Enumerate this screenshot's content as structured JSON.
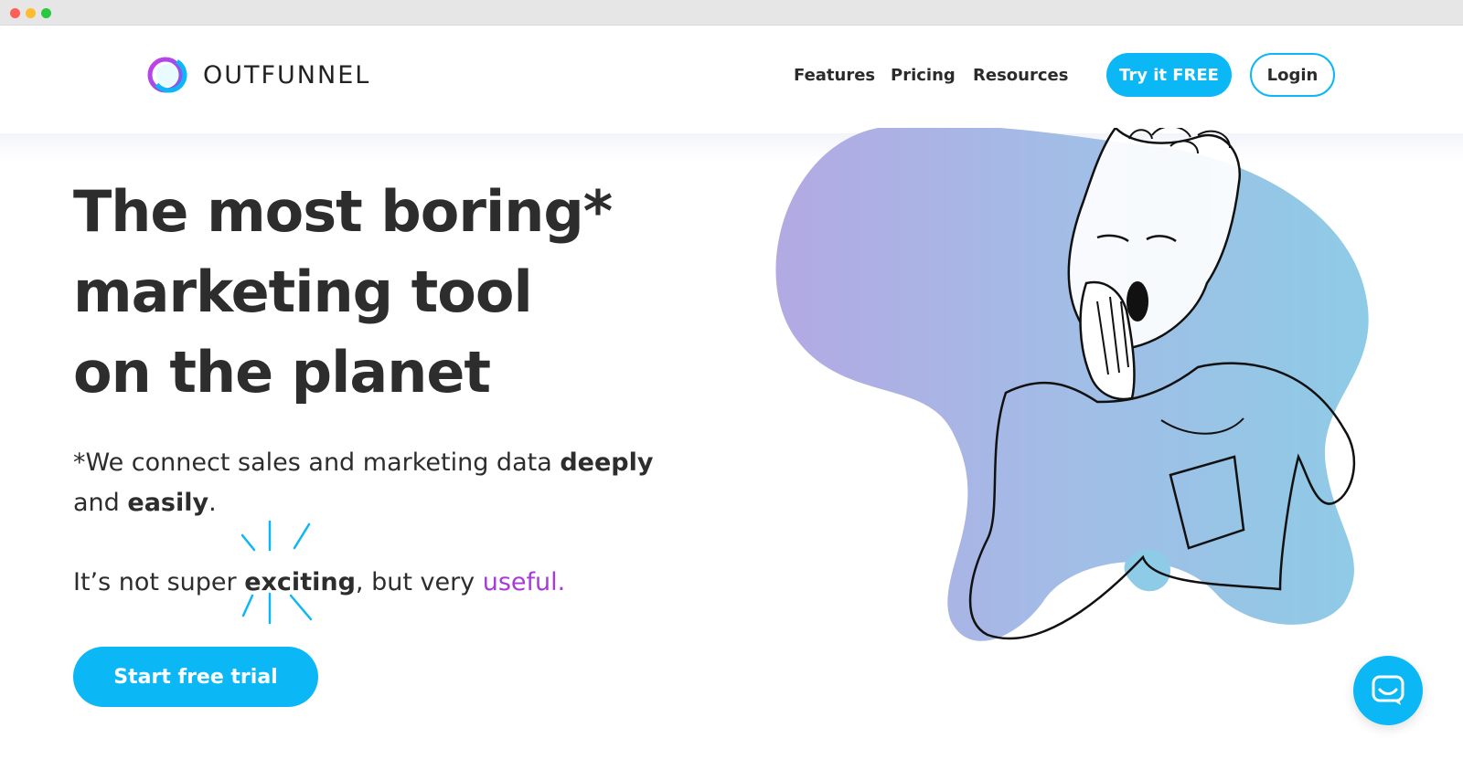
{
  "brand": {
    "name": "OUTFUNNEL",
    "primary_color": "#0bb8f5",
    "accent_color": "#a63bd8"
  },
  "nav": {
    "links": [
      {
        "label": "Features"
      },
      {
        "label": "Pricing"
      },
      {
        "label": "Resources"
      }
    ],
    "try_label": "Try it FREE",
    "login_label": "Login"
  },
  "hero": {
    "headline": [
      "The most boring*",
      "marketing tool",
      "on the planet"
    ],
    "sub1": {
      "part1": "*We connect sales and marketing data ",
      "bold1": "deeply",
      "part2": " and ",
      "bold2": "easily",
      "part3": "."
    },
    "sub2": {
      "part1": "It’s not super ",
      "bold": "exciting",
      "part2": ", but very ",
      "highlight": "useful."
    },
    "cta_label": "Start free trial"
  },
  "illustration": {
    "subject": "yawning-person-illustration"
  },
  "chat": {
    "icon": "chat-bubble-icon"
  }
}
